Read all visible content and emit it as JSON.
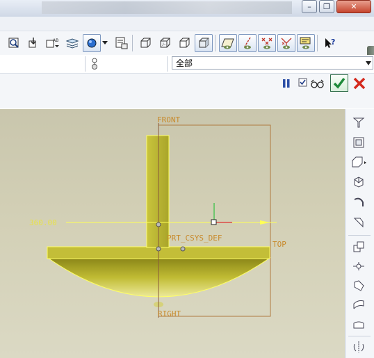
{
  "window": {
    "minimize_icon": "minimize-icon",
    "restore_icon": "restore-icon",
    "close_icon": "close-icon"
  },
  "toolbar": {
    "tools": [
      "zoom-window-icon",
      "reorient-icon",
      "saved-views-icon",
      "layers-icon",
      "display-style-icon",
      "named-view-icon",
      "wireframe-icon",
      "hidden-line-icon",
      "no-hidden-icon",
      "shading-icon",
      "datum-planes-icon",
      "datum-axes-icon",
      "datum-points-icon",
      "coordinate-systems-icon",
      "annotation-icon",
      "context-help-icon"
    ]
  },
  "filter": {
    "value": "全部"
  },
  "dashboard": {
    "pause_icon": "pause-icon",
    "preview_icon": "verify-preview-icon",
    "ok_icon": "ok-checkmark-icon",
    "cancel_icon": "cancel-x-icon"
  },
  "canvas": {
    "front_label": "FRONT",
    "top_label": "TOP",
    "right_label": "RIGHT",
    "csys_label": "PRT_CSYS_DEF",
    "dim_label": "360.00",
    "colors": {
      "part": "#c2bd3a",
      "datum": "#c88a2c",
      "axis_x": "#e03030",
      "axis_y": "#30c040"
    }
  },
  "right_tools": [
    "datum-plane-tool-icon",
    "datum-axis-tool-icon",
    "datum-point-tool-icon",
    "sketch-tool-icon",
    "revolve-tool-icon",
    "sweep-tool-icon",
    "extrude-tool-icon",
    "round-tool-icon",
    "chamfer-tool-icon",
    "draft-tool-icon",
    "shell-tool-icon",
    "mirror-tool-icon"
  ]
}
